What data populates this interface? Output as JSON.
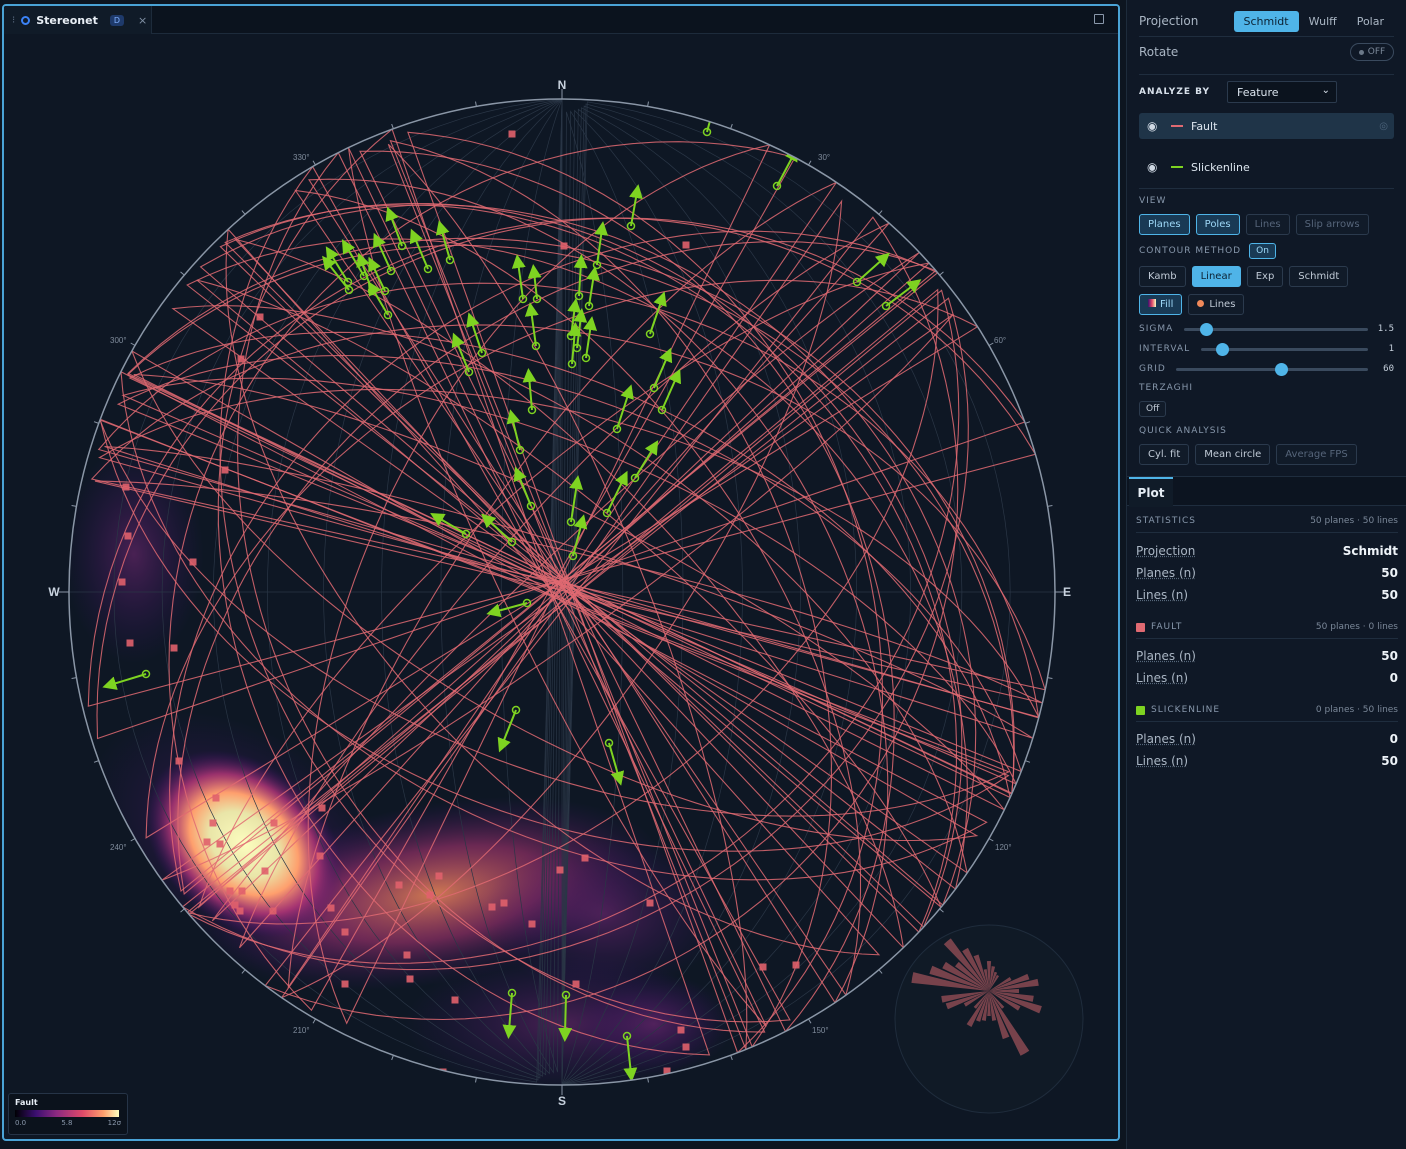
{
  "tab": {
    "title": "Stereonet",
    "badge": "D",
    "close": "×"
  },
  "stereonet": {
    "cardinals": {
      "n": "N",
      "e": "E",
      "s": "S",
      "w": "W"
    },
    "azimuth_labels": [
      "30°",
      "60°",
      "120°",
      "150°",
      "210°",
      "240°",
      "300°",
      "330°"
    ],
    "plane_color": "#e06a72",
    "pole_color": "#e0606c",
    "line_color": "#7ed321"
  },
  "legend": {
    "title": "Fault",
    "min": "0.0",
    "mid": "5.8",
    "max": "12σ"
  },
  "sidebar": {
    "projection": {
      "label": "Projection",
      "options": [
        "Schmidt",
        "Wulff",
        "Polar"
      ],
      "selected": "Schmidt"
    },
    "rotate": {
      "label": "Rotate",
      "state": "OFF"
    },
    "analyze_by": {
      "label": "ANALYZE BY",
      "value": "Feature"
    },
    "layers": [
      {
        "name": "Fault",
        "color": "#e06a72"
      },
      {
        "name": "Slickenline",
        "color": "#7ed321"
      }
    ],
    "view": {
      "label": "VIEW",
      "buttons": [
        "Planes",
        "Poles",
        "Lines",
        "Slip arrows"
      ]
    },
    "contour_method": {
      "label": "CONTOUR METHOD",
      "toggle": "On",
      "methods": [
        "Kamb",
        "Linear",
        "Exp",
        "Schmidt"
      ],
      "selected": "Linear"
    },
    "fill_lines": {
      "fill": "Fill",
      "lines": "Lines"
    },
    "sliders": {
      "sigma": {
        "label": "SIGMA",
        "value": "1.5"
      },
      "interval": {
        "label": "INTERVAL",
        "value": "1"
      },
      "grid": {
        "label": "GRID",
        "value": "60"
      }
    },
    "terzaghi": {
      "label": "TERZAGHI",
      "value": "Off"
    },
    "quick_analysis": {
      "label": "QUICK ANALYSIS",
      "buttons": [
        "Cyl. fit",
        "Mean circle",
        "Average FPS"
      ]
    }
  },
  "plot": {
    "tab": "Plot",
    "statistics": {
      "label": "STATISTICS",
      "summary": "50 planes · 50 lines",
      "rows": [
        {
          "k": "Projection",
          "v": "Schmidt"
        },
        {
          "k": "Planes (n)",
          "v": "50"
        },
        {
          "k": "Lines (n)",
          "v": "50"
        }
      ]
    },
    "fault": {
      "label": "FAULT",
      "summary": "50 planes · 0 lines",
      "color": "#e06a72",
      "rows": [
        {
          "k": "Planes (n)",
          "v": "50"
        },
        {
          "k": "Lines (n)",
          "v": "0"
        }
      ]
    },
    "slickenline": {
      "label": "SLICKENLINE",
      "summary": "0 planes · 50 lines",
      "color": "#7ed321",
      "rows": [
        {
          "k": "Planes (n)",
          "v": "0"
        },
        {
          "k": "Lines (n)",
          "v": "50"
        }
      ]
    }
  }
}
